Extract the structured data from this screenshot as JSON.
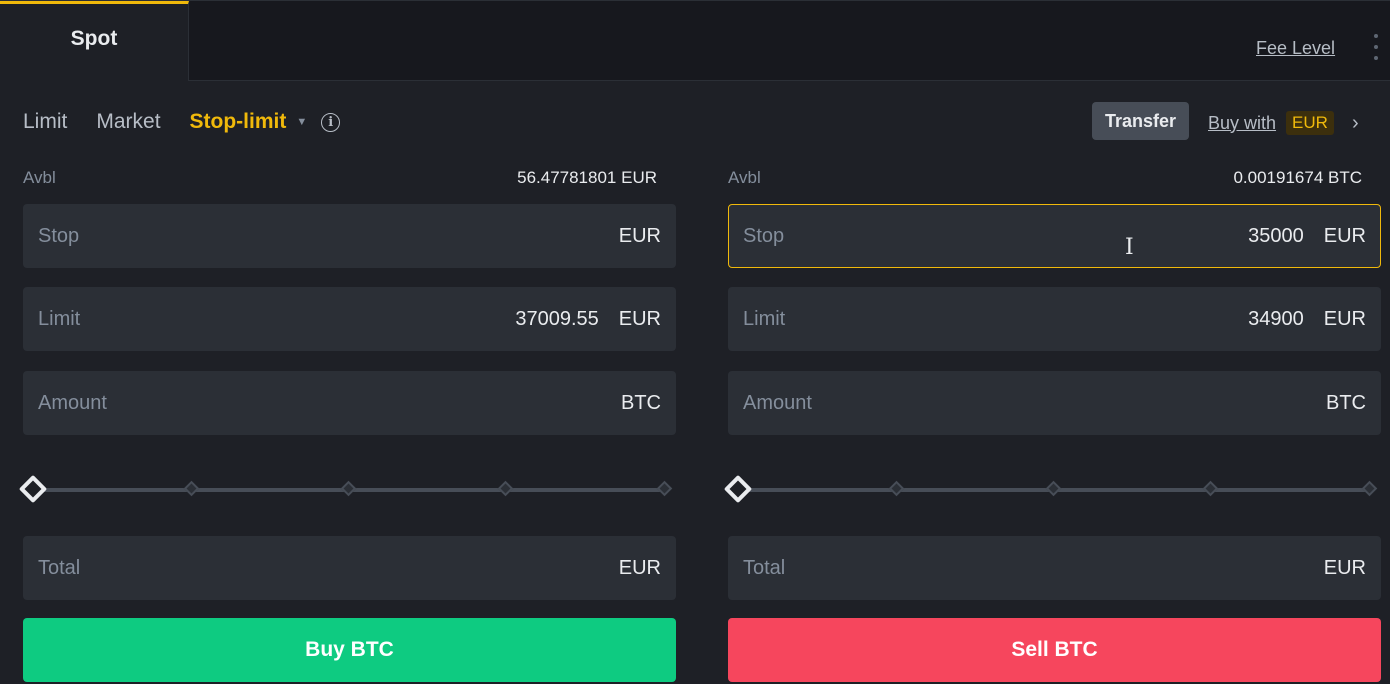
{
  "tabs": {
    "spot": "Spot",
    "fee_level": "Fee Level"
  },
  "order_types": {
    "limit": "Limit",
    "market": "Market",
    "stop_limit": "Stop-limit"
  },
  "toolbar": {
    "transfer": "Transfer",
    "buy_with": "Buy with",
    "buy_with_currency": "EUR"
  },
  "buy_panel": {
    "avbl_label": "Avbl",
    "avbl_value": "56.47781801 EUR",
    "stop": {
      "label": "Stop",
      "value": "",
      "unit": "EUR"
    },
    "limit": {
      "label": "Limit",
      "value": "37009.55",
      "unit": "EUR"
    },
    "amount": {
      "label": "Amount",
      "value": "",
      "unit": "BTC"
    },
    "slider_percent": 0,
    "total": {
      "label": "Total",
      "value": "",
      "unit": "EUR"
    },
    "button": "Buy BTC"
  },
  "sell_panel": {
    "avbl_label": "Avbl",
    "avbl_value": "0.00191674 BTC",
    "stop": {
      "label": "Stop",
      "value": "35000",
      "unit": "EUR"
    },
    "limit": {
      "label": "Limit",
      "value": "34900",
      "unit": "EUR"
    },
    "amount": {
      "label": "Amount",
      "value": "",
      "unit": "BTC"
    },
    "slider_percent": 0,
    "total": {
      "label": "Total",
      "value": "",
      "unit": "EUR"
    },
    "button": "Sell BTC"
  },
  "colors": {
    "accent": "#f0b90b",
    "buy": "#0ecb81",
    "sell": "#f6465d",
    "background": "#1e2026",
    "field": "#2b2f36"
  },
  "icons": {
    "info": "info-circle-icon",
    "dropdown": "caret-down-icon",
    "chevron": "chevron-right-icon",
    "menu": "kebab-menu-icon"
  }
}
